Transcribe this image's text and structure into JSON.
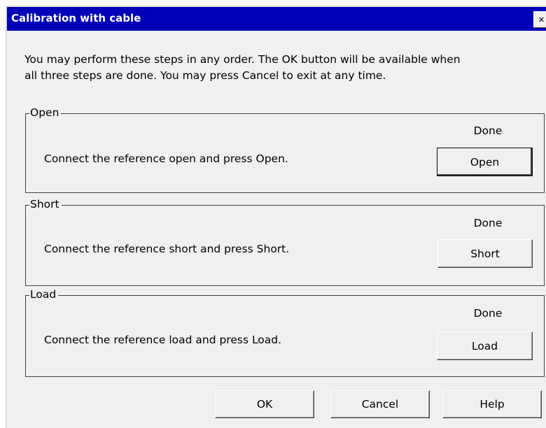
{
  "window": {
    "title": "Calibration with cable",
    "close_glyph": "×"
  },
  "intro_lines": [
    "You may perform these steps in any order. The OK button will be available when",
    "all three steps are done. You may press Cancel to exit at any time."
  ],
  "steps": [
    {
      "legend": "Open",
      "status": "Done",
      "instruction": "Connect the reference open and press Open.",
      "button_label": "Open",
      "is_default": true
    },
    {
      "legend": "Short",
      "status": "Done",
      "instruction": "Connect the reference short and press Short.",
      "button_label": "Short",
      "is_default": false
    },
    {
      "legend": "Load",
      "status": "Done",
      "instruction": "Connect the reference load and press Load.",
      "button_label": "Load",
      "is_default": false
    }
  ],
  "footer": {
    "ok_label": "OK",
    "cancel_label": "Cancel",
    "help_label": "Help"
  },
  "colors": {
    "titlebar": "#0000b8",
    "title_text": "#ffffff",
    "dialog_face": "#f0f0f0"
  }
}
